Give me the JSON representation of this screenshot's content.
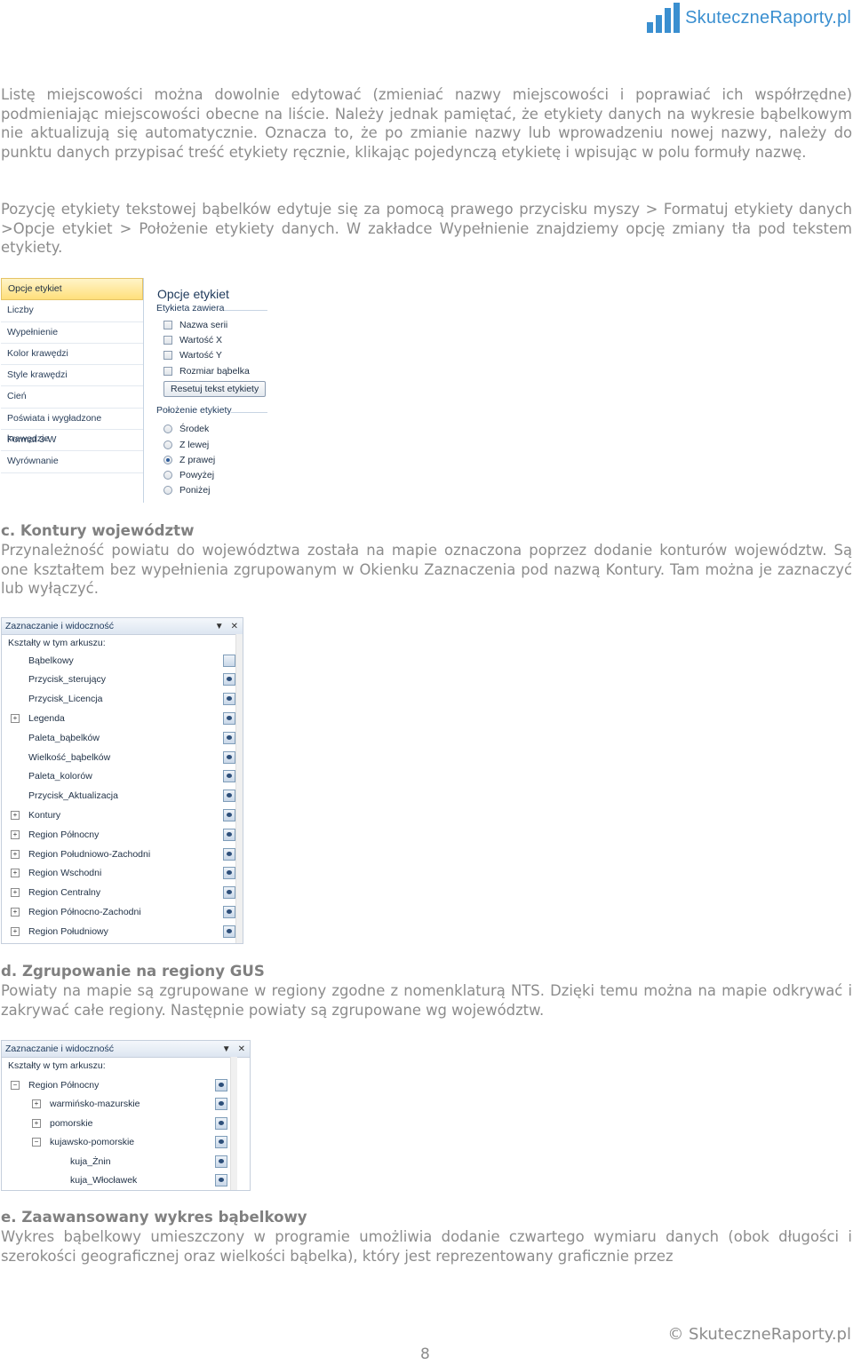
{
  "header": {
    "logo_text": "SkuteczneRaporty.pl",
    "brand_color": "#3a8fd0"
  },
  "paragraphs": {
    "p1": "Listę miejscowości można dowolnie edytować (zmieniać nazwy miejscowości i poprawiać ich współrzędne) podmieniając miejscowości obecne na liście. Należy jednak pamiętać, że etykiety danych na wykresie bąbelkowym nie aktualizują się automatycznie. Oznacza to, że po zmianie nazwy lub wprowadzeniu nowej nazwy, należy do punktu danych przypisać treść etykiety ręcznie, klikając pojedynczą etykietę i wpisując w polu formuły nazwę.",
    "p2": "Pozycję etykiety tekstowej bąbelków edytuje się za pomocą prawego przycisku myszy > Formatuj etykiety danych >Opcje etykiet > Położenie etykiety danych. W zakładce Wypełnienie znajdziemy opcję zmiany tła pod tekstem etykiety.",
    "c_heading": "c. Kontury województw",
    "c_text": "Przynależność powiatu do województwa została na mapie oznaczona poprzez dodanie konturów województw. Są one kształtem bez wypełnienia zgrupowanym w Okienku Zaznaczenia pod nazwą Kontury. Tam można je zaznaczyć lub wyłączyć.",
    "d_heading": "d. Zgrupowanie na regiony GUS",
    "d_text": "Powiaty na mapie są zgrupowane w regiony zgodne z nomenklaturą NTS. Dzięki temu można na mapie odkrywać i zakrywać całe regiony. Następnie powiaty są zgrupowane wg województw.",
    "e_heading": "e. Zaawansowany wykres bąbelkowy",
    "e_text": "Wykres bąbelkowy umieszczony w programie umożliwia dodanie czwartego wymiaru danych (obok długości i szerokości geograficznej oraz wielkości bąbelka), który jest reprezentowany graficznie przez"
  },
  "format_dialog": {
    "nav": [
      "Opcje etykiet",
      "Liczby",
      "Wypełnienie",
      "Kolor krawędzi",
      "Style krawędzi",
      "Cień",
      "Poświata i wygładzone krawędzie",
      "Format 3-W",
      "Wyrównanie"
    ],
    "pane_title": "Opcje etykiet",
    "contains_label": "Etykieta zawiera",
    "checkboxes": [
      "Nazwa serii",
      "Wartość X",
      "Wartość Y",
      "Rozmiar bąbelka"
    ],
    "reset_button": "Resetuj tekst etykiety",
    "position_label": "Położenie etykiety",
    "radios": [
      "Środek",
      "Z lewej",
      "Z prawej",
      "Powyżej",
      "Poniżej"
    ],
    "selected_radio": "Z prawej"
  },
  "selection_pane_1": {
    "title": "Zaznaczanie i widoczność",
    "subtitle": "Kształty w tym arkuszu:",
    "items": [
      {
        "label": "Bąbelkowy",
        "expandable": false,
        "visible": false
      },
      {
        "label": "Przycisk_sterujący",
        "expandable": false,
        "visible": true
      },
      {
        "label": "Przycisk_Licencja",
        "expandable": false,
        "visible": true
      },
      {
        "label": "Legenda",
        "expandable": true,
        "visible": true
      },
      {
        "label": "Paleta_bąbelków",
        "expandable": false,
        "visible": true
      },
      {
        "label": "Wielkość_bąbelków",
        "expandable": false,
        "visible": true
      },
      {
        "label": "Paleta_kolorów",
        "expandable": false,
        "visible": true
      },
      {
        "label": "Przycisk_Aktualizacja",
        "expandable": false,
        "visible": true
      },
      {
        "label": "Kontury",
        "expandable": true,
        "visible": true
      },
      {
        "label": "Region Północny",
        "expandable": true,
        "visible": true
      },
      {
        "label": "Region Południowo-Zachodni",
        "expandable": true,
        "visible": true
      },
      {
        "label": "Region Wschodni",
        "expandable": true,
        "visible": true
      },
      {
        "label": "Region Centralny",
        "expandable": true,
        "visible": true
      },
      {
        "label": "Region Północno-Zachodni",
        "expandable": true,
        "visible": true
      },
      {
        "label": "Region Południowy",
        "expandable": true,
        "visible": true
      }
    ]
  },
  "selection_pane_2": {
    "title": "Zaznaczanie i widoczność",
    "subtitle": "Kształty w tym arkuszu:",
    "items": [
      {
        "label": "Region Północny",
        "toggle": "minus",
        "level": 0
      },
      {
        "label": "warmińsko-mazurskie",
        "toggle": "plus",
        "level": 1
      },
      {
        "label": "pomorskie",
        "toggle": "plus",
        "level": 1
      },
      {
        "label": "kujawsko-pomorskie",
        "toggle": "minus",
        "level": 1
      },
      {
        "label": "kuja_Żnin",
        "toggle": "none",
        "level": 2
      },
      {
        "label": "kuja_Włocławek",
        "toggle": "none",
        "level": 2
      }
    ]
  },
  "footer": {
    "page_number": "8",
    "copyright": "© SkuteczneRaporty.pl"
  }
}
